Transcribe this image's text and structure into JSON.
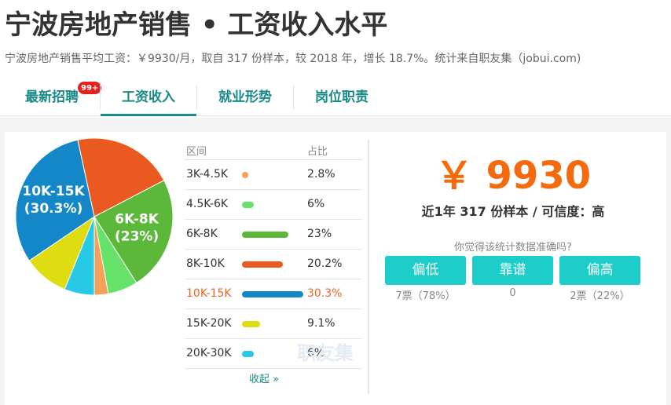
{
  "header": {
    "title": "宁波房地产销售 • 工资收入水平",
    "subtitle": "宁波房地产销售平均工资：￥9930/月，取自 317 份样本，较 2018 年，增长 18.7%。统计来自职友集（jobui.com)"
  },
  "tabs": [
    {
      "label": "最新招聘",
      "badge": "99+"
    },
    {
      "label": "工资收入",
      "active": true
    },
    {
      "label": "就业形势"
    },
    {
      "label": "岗位职责"
    }
  ],
  "table": {
    "col_range": "区间",
    "col_pct": "占比",
    "collapse": "收起 »"
  },
  "watermark": "职友集",
  "chart_data": {
    "type": "pie",
    "categories": [
      "3K-4.5K",
      "4.5K-6K",
      "6K-8K",
      "8K-10K",
      "10K-15K",
      "15K-20K",
      "20K-30K"
    ],
    "values": [
      2.8,
      6,
      23,
      20.2,
      30.3,
      9.1,
      6
    ],
    "value_labels": [
      "2.8%",
      "6%",
      "23%",
      "20.2%",
      "30.3%",
      "9.1%",
      "6%"
    ],
    "colors": [
      "#f5a05a",
      "#66e26a",
      "#5bb83a",
      "#ea5a20",
      "#1387c7",
      "#dddd12",
      "#28c9e6"
    ],
    "highlight": "10K-15K",
    "slice_labels": [
      {
        "category": "10K-15K",
        "line1": "10K-15K",
        "line2": "(30.3%)"
      },
      {
        "category": "6K-8K",
        "line1": "6K-8K",
        "line2": "(23%)"
      }
    ]
  },
  "summary": {
    "salary": "￥ 9930",
    "sample": "近1年 317 份样本 / 可信度：高",
    "question": "你觉得该统计数据准确吗?"
  },
  "votes": [
    {
      "label": "偏低",
      "count": "7票（78%）"
    },
    {
      "label": "靠谱",
      "count": "0"
    },
    {
      "label": "偏高",
      "count": "2票（22%）"
    }
  ]
}
